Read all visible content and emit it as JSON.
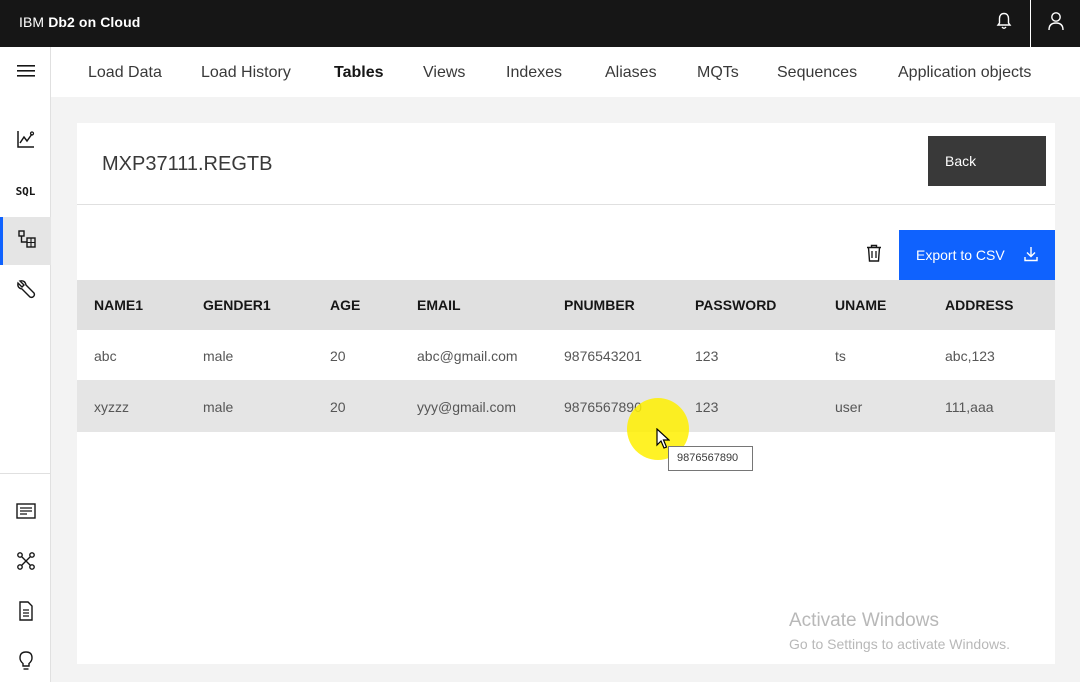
{
  "topbar": {
    "brand_prefix": "IBM ",
    "brand_name": "Db2 on Cloud"
  },
  "icons": {
    "bell": "bell-icon",
    "user": "user-icon",
    "menu": "hamburger-menu-icon",
    "monitor": "chart-line-icon",
    "tables": "table-tree-icon",
    "tools": "wrench-icon",
    "docs": "list-document-icon",
    "connect": "network-icon",
    "file": "file-icon",
    "idea": "lightbulb-icon",
    "trash": "trash-icon",
    "download": "download-icon",
    "cursor": "mouse-pointer-icon"
  },
  "sidebar": {
    "sql_label": "SQL"
  },
  "tabs": [
    {
      "label": "Load Data"
    },
    {
      "label": "Load History"
    },
    {
      "label": "Tables"
    },
    {
      "label": "Views"
    },
    {
      "label": "Indexes"
    },
    {
      "label": "Aliases"
    },
    {
      "label": "MQTs"
    },
    {
      "label": "Sequences"
    },
    {
      "label": "Application objects"
    }
  ],
  "active_tab": "Tables",
  "card": {
    "title": "MXP37111.REGTB",
    "back_label": "Back",
    "export_label": "Export to CSV"
  },
  "table": {
    "columns": [
      "NAME1",
      "GENDER1",
      "AGE",
      "EMAIL",
      "PNUMBER",
      "PASSWORD",
      "UNAME",
      "ADDRESS"
    ],
    "rows": [
      [
        "abc",
        "male",
        "20",
        "abc@gmail.com",
        "9876543201",
        "123",
        "ts",
        "abc,123"
      ],
      [
        "xyzzz",
        "male",
        "20",
        "yyy@gmail.com",
        "9876567890",
        "123",
        "user",
        "111,aaa"
      ]
    ]
  },
  "tooltip": {
    "text": "9876567890"
  },
  "watermark": {
    "title": "Activate Windows",
    "subtitle": "Go to Settings to activate Windows."
  },
  "colors": {
    "accent": "#0f62fe",
    "topbar": "#161616",
    "back_button": "#393939",
    "highlight": "#fff000"
  }
}
